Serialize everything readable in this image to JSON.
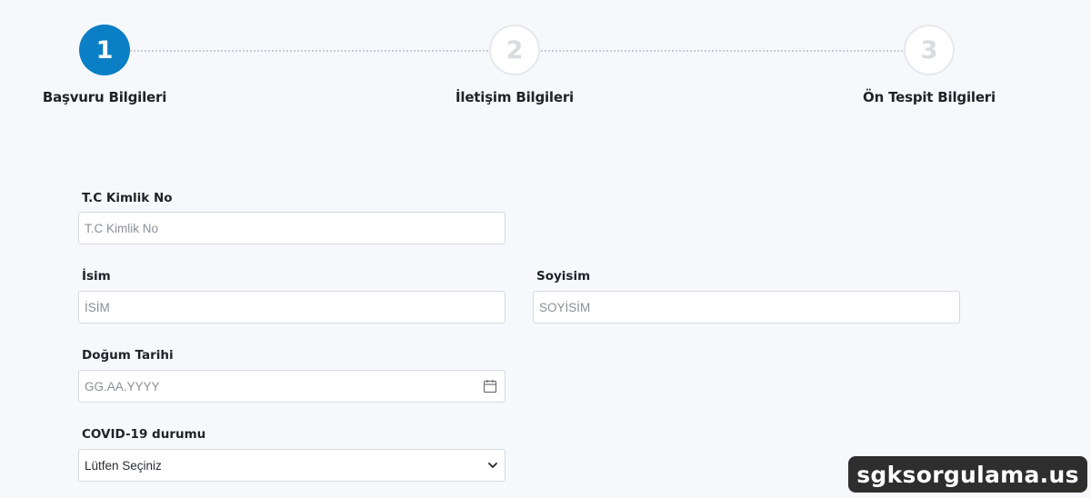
{
  "stepper": {
    "steps": [
      {
        "number": "1",
        "label": "Başvuru Bilgileri",
        "state": "active"
      },
      {
        "number": "2",
        "label": "İletişim Bilgileri",
        "state": "inactive"
      },
      {
        "number": "3",
        "label": "Ön Tespit Bilgileri",
        "state": "inactive"
      }
    ]
  },
  "form": {
    "tc": {
      "label": "T.C Kimlik No",
      "placeholder": "T.C Kimlik No"
    },
    "name": {
      "label": "İsim",
      "placeholder": "İSİM"
    },
    "surname": {
      "label": "Soyisim",
      "placeholder": "SOYİSİM"
    },
    "birthdate": {
      "label": "Doğum Tarihi",
      "placeholder": "GG.AA.YYYY",
      "icon": "calendar-icon"
    },
    "covid": {
      "label": "COVID-19 durumu",
      "selected": "Lütfen Seçiniz",
      "icon": "chevron-down-icon"
    }
  },
  "watermark": {
    "text": "sgksorgulama.us"
  },
  "colors": {
    "accent": "#0b7fc6",
    "background": "#f6f8fb",
    "border": "#d6dadf"
  }
}
